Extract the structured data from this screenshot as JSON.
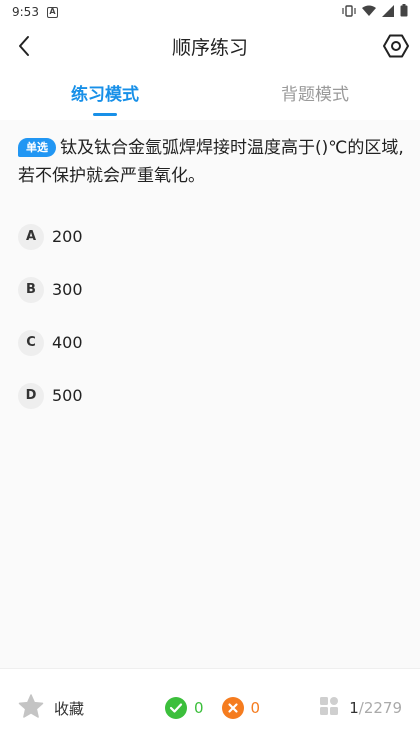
{
  "status_bar": {
    "time": "9:53",
    "notification_letter": "A"
  },
  "header": {
    "title": "顺序练习"
  },
  "mode_tabs": [
    {
      "label": "练习模式",
      "active": true
    },
    {
      "label": "背题模式",
      "active": false
    }
  ],
  "question": {
    "type_badge": "单选",
    "text": "钛及钛合金氩弧焊焊接时温度高于()℃的区域,若不保护就会严重氧化。",
    "options": [
      {
        "letter": "A",
        "text": "200"
      },
      {
        "letter": "B",
        "text": "300"
      },
      {
        "letter": "C",
        "text": "400"
      },
      {
        "letter": "D",
        "text": "500"
      }
    ]
  },
  "bottom_bar": {
    "favorite_label": "收藏",
    "correct_count": "0",
    "wrong_count": "0",
    "progress_current": "1",
    "progress_total": "/2279"
  },
  "colors": {
    "accent": "#1890e8",
    "correct": "#3cbf3c",
    "wrong": "#f57c1f",
    "badge": "#2196f3"
  },
  "icons": {
    "back": "chevron-left-icon",
    "settings": "hexagon-gear-icon",
    "favorite": "star-icon",
    "correct": "check-circle-icon",
    "wrong": "x-circle-icon",
    "grid": "grid-icon"
  }
}
